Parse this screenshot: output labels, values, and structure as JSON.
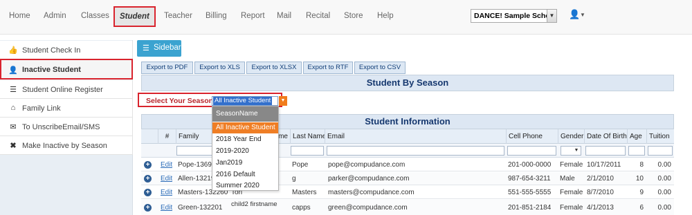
{
  "nav": {
    "items": [
      "Home",
      "Admin",
      "Classes",
      "Student",
      "Teacher",
      "Billing",
      "Report",
      "Mail",
      "Recital",
      "Store",
      "Help"
    ],
    "active": "Student",
    "school": "DANCE! Sample School"
  },
  "sidebar": {
    "items": [
      {
        "icon": "thumbs-up-icon",
        "label": "Student Check In"
      },
      {
        "icon": "user-icon",
        "label": "Inactive Student"
      },
      {
        "icon": "list-icon",
        "label": "Student Online Register"
      },
      {
        "icon": "home-icon",
        "label": "Family Link"
      },
      {
        "icon": "envelope-icon",
        "label": "To UnscribeEmail/SMS"
      },
      {
        "icon": "x-icon",
        "label": "Make Inactive by Season"
      }
    ],
    "toggle_label": "Sidebar"
  },
  "exports": [
    "Export to PDF",
    "Export to XLS",
    "Export to XLSX",
    "Export to RTF",
    "Export to CSV"
  ],
  "season_panel": {
    "title": "Student By Season",
    "select_label": "Select Your Seasons:",
    "selected": "All Inactive Student"
  },
  "dropdown": {
    "header": "SeasonName",
    "options": [
      "All Inactive Student",
      "2018 Year End",
      "2019-2020",
      "Jan2019",
      "2016 Default",
      "Summer 2020"
    ],
    "selected_index": 0
  },
  "table": {
    "title": "Student Information",
    "columns": [
      "#",
      "Family",
      "me",
      "Last Name",
      "Email",
      "Cell Phone",
      "Gender",
      "Date Of Birth",
      "Age",
      "Tuition"
    ],
    "edit_label": "Edit",
    "rows": [
      {
        "family": "Pope-13699",
        "first": "",
        "last": "Pope",
        "email": "pope@compudance.com",
        "phone": "201-000-0000",
        "gender": "Female",
        "dob": "10/17/2011",
        "age": "8",
        "tuition": "0.00"
      },
      {
        "family": "Allen-13219",
        "first": "",
        "last": "g",
        "email": "parker@compudance.com",
        "phone": "987-654-3211",
        "gender": "Male",
        "dob": "2/1/2010",
        "age": "10",
        "tuition": "0.00"
      },
      {
        "family": "Masters-132260",
        "first": "Tori",
        "last": "Masters",
        "email": "masters@compudance.com",
        "phone": "551-555-5555",
        "gender": "Female",
        "dob": "8/7/2010",
        "age": "9",
        "tuition": "0.00"
      },
      {
        "family": "Green-132201",
        "first": "child2 firstname",
        "last": "capps",
        "email": "green@compudance.com",
        "phone": "201-851-2184",
        "gender": "Female",
        "dob": "4/1/2013",
        "age": "6",
        "tuition": "0.00"
      }
    ]
  },
  "colors": {
    "accent": "#3ba3d0",
    "highlight": "#d9232d",
    "select_orange": "#ef7e25",
    "title_blue": "#16386f"
  }
}
